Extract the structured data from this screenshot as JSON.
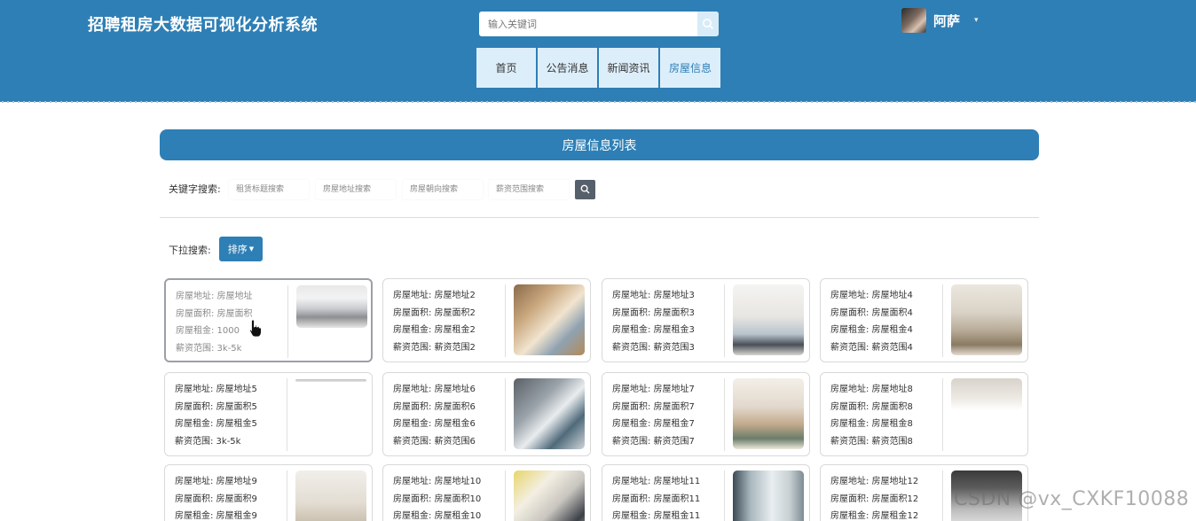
{
  "header": {
    "title": "招聘租房大数据可视化分析系统",
    "search_placeholder": "输入关键词",
    "username": "阿萨",
    "caret": "▾"
  },
  "nav": {
    "items": [
      {
        "label": "首页"
      },
      {
        "label": "公告消息"
      },
      {
        "label": "新闻资讯"
      },
      {
        "label": "房屋信息"
      }
    ]
  },
  "panel": {
    "title": "房屋信息列表",
    "keyword_label": "关键字搜索:",
    "keyword_placeholders": [
      "租赁标题搜索",
      "房屋地址搜索",
      "房屋朝向搜索",
      "薪资范围搜索"
    ],
    "dropdown_label": "下拉搜索:",
    "sort_label": "排序"
  },
  "cards": [
    {
      "lines": [
        "房屋地址: 房屋地址",
        "房屋面积: 房屋面积",
        "房屋租金: 1000",
        "薪资范围: 3k-5k"
      ]
    },
    {
      "lines": [
        "房屋地址: 房屋地址2",
        "房屋面积: 房屋面积2",
        "房屋租金: 房屋租金2",
        "薪资范围: 薪资范围2"
      ]
    },
    {
      "lines": [
        "房屋地址: 房屋地址3",
        "房屋面积: 房屋面积3",
        "房屋租金: 房屋租金3",
        "薪资范围: 薪资范围3"
      ]
    },
    {
      "lines": [
        "房屋地址: 房屋地址4",
        "房屋面积: 房屋面积4",
        "房屋租金: 房屋租金4",
        "薪资范围: 薪资范围4"
      ]
    },
    {
      "lines": [
        "房屋地址: 房屋地址5",
        "房屋面积: 房屋面积5",
        "房屋租金: 房屋租金5",
        "薪资范围: 3k-5k"
      ]
    },
    {
      "lines": [
        "房屋地址: 房屋地址6",
        "房屋面积: 房屋面积6",
        "房屋租金: 房屋租金6",
        "薪资范围: 薪资范围6"
      ]
    },
    {
      "lines": [
        "房屋地址: 房屋地址7",
        "房屋面积: 房屋面积7",
        "房屋租金: 房屋租金7",
        "薪资范围: 薪资范围7"
      ]
    },
    {
      "lines": [
        "房屋地址: 房屋地址8",
        "房屋面积: 房屋面积8",
        "房屋租金: 房屋租金8",
        "薪资范围: 薪资范围8"
      ]
    },
    {
      "lines": [
        "房屋地址: 房屋地址9",
        "房屋面积: 房屋面积9",
        "房屋租金: 房屋租金9"
      ]
    },
    {
      "lines": [
        "房屋地址: 房屋地址10",
        "房屋面积: 房屋面积10",
        "房屋租金: 房屋租金10"
      ]
    },
    {
      "lines": [
        "房屋地址: 房屋地址11",
        "房屋面积: 房屋面积11",
        "房屋租金: 房屋租金11"
      ]
    },
    {
      "lines": [
        "房屋地址: 房屋地址12",
        "房屋面积: 房屋面积12",
        "房屋租金: 房屋租金12"
      ]
    }
  ],
  "watermark": "CSDN @vx_CXKF10088",
  "colors": {
    "primary": "#2e7fb5",
    "nav_bg": "#ddeefb",
    "search_btn": "#56606b"
  }
}
